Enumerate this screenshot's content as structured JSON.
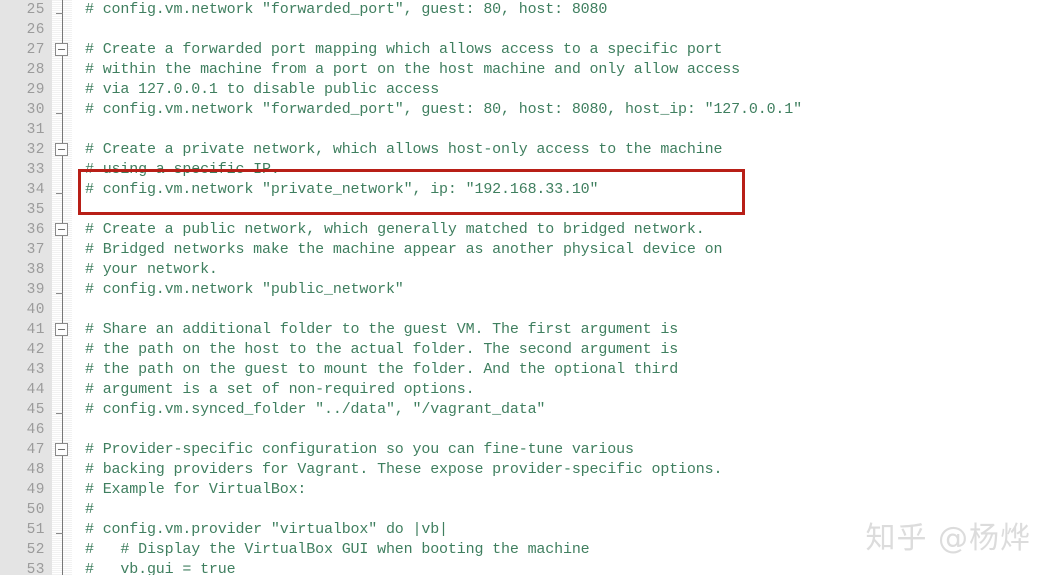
{
  "editor": {
    "language": "ruby",
    "file_kind": "Vagrantfile",
    "theme": {
      "background": "#ffffff",
      "gutter_background": "#e4e4e4",
      "line_number_color": "#9b9b9b",
      "comment_color": "#3f7f5f",
      "fold_line_color": "#777777",
      "annotation_color": "#b81f17"
    },
    "first_visible_line": 25,
    "last_visible_line": 53,
    "line_height_px": 20
  },
  "lines": [
    {
      "n": 25,
      "text": "# config.vm.network \"forwarded_port\", guest: 80, host: 8080",
      "fold": "tick"
    },
    {
      "n": 26,
      "text": "",
      "fold": "none"
    },
    {
      "n": 27,
      "text": "# Create a forwarded port mapping which allows access to a specific port",
      "fold": "box"
    },
    {
      "n": 28,
      "text": "# within the machine from a port on the host machine and only allow access",
      "fold": "none"
    },
    {
      "n": 29,
      "text": "# via 127.0.0.1 to disable public access",
      "fold": "none"
    },
    {
      "n": 30,
      "text": "# config.vm.network \"forwarded_port\", guest: 80, host: 8080, host_ip: \"127.0.0.1\"",
      "fold": "tick"
    },
    {
      "n": 31,
      "text": "",
      "fold": "none"
    },
    {
      "n": 32,
      "text": "# Create a private network, which allows host-only access to the machine",
      "fold": "box"
    },
    {
      "n": 33,
      "text": "# using a specific IP.",
      "fold": "none"
    },
    {
      "n": 34,
      "text": "# config.vm.network \"private_network\", ip: \"192.168.33.10\"",
      "fold": "tick"
    },
    {
      "n": 35,
      "text": "",
      "fold": "none"
    },
    {
      "n": 36,
      "text": "# Create a public network, which generally matched to bridged network.",
      "fold": "box"
    },
    {
      "n": 37,
      "text": "# Bridged networks make the machine appear as another physical device on",
      "fold": "none"
    },
    {
      "n": 38,
      "text": "# your network.",
      "fold": "none"
    },
    {
      "n": 39,
      "text": "# config.vm.network \"public_network\"",
      "fold": "tick"
    },
    {
      "n": 40,
      "text": "",
      "fold": "none"
    },
    {
      "n": 41,
      "text": "# Share an additional folder to the guest VM. The first argument is",
      "fold": "box"
    },
    {
      "n": 42,
      "text": "# the path on the host to the actual folder. The second argument is",
      "fold": "none"
    },
    {
      "n": 43,
      "text": "# the path on the guest to mount the folder. And the optional third",
      "fold": "none"
    },
    {
      "n": 44,
      "text": "# argument is a set of non-required options.",
      "fold": "none"
    },
    {
      "n": 45,
      "text": "# config.vm.synced_folder \"../data\", \"/vagrant_data\"",
      "fold": "tick"
    },
    {
      "n": 46,
      "text": "",
      "fold": "none"
    },
    {
      "n": 47,
      "text": "# Provider-specific configuration so you can fine-tune various",
      "fold": "box"
    },
    {
      "n": 48,
      "text": "# backing providers for Vagrant. These expose provider-specific options.",
      "fold": "none"
    },
    {
      "n": 49,
      "text": "# Example for VirtualBox:",
      "fold": "none"
    },
    {
      "n": 50,
      "text": "#",
      "fold": "none"
    },
    {
      "n": 51,
      "text": "# config.vm.provider \"virtualbox\" do |vb|",
      "fold": "tick"
    },
    {
      "n": 52,
      "text": "#   # Display the VirtualBox GUI when booting the machine",
      "fold": "none"
    },
    {
      "n": 53,
      "text": "#   vb.gui = true",
      "fold": "none"
    }
  ],
  "annotation": {
    "type": "rectangle-highlight",
    "color": "#b81f17",
    "covers_lines": [
      33,
      34,
      35
    ],
    "highlighted_text": "# config.vm.network \"private_network\", ip: \"192.168.33.10\""
  },
  "watermark": {
    "text": "知乎 @杨烨",
    "color": "#dcdcdc"
  }
}
